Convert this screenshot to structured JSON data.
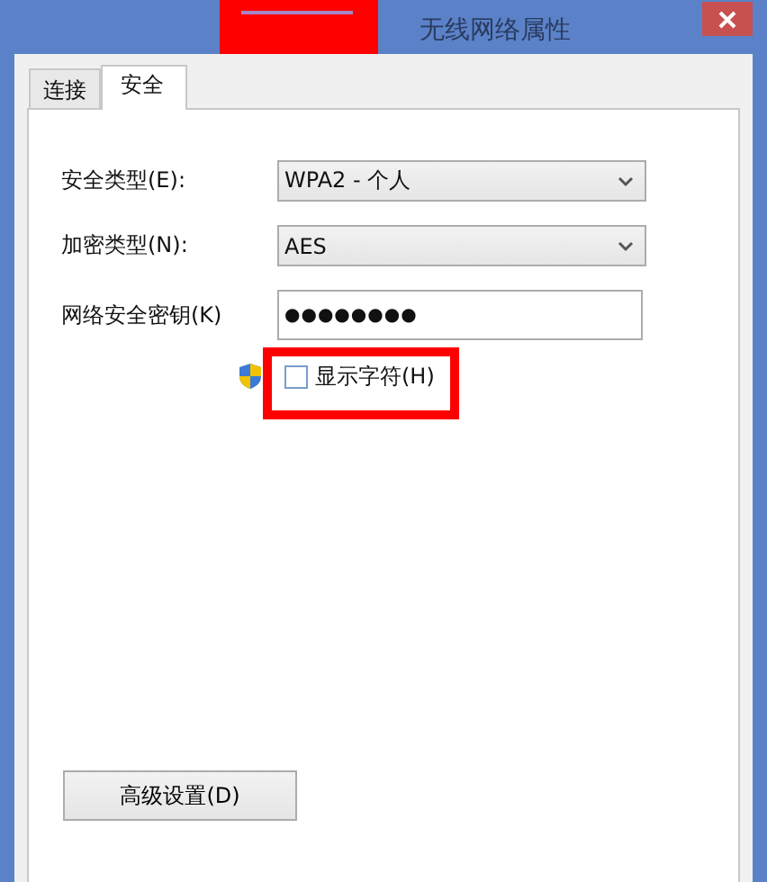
{
  "window": {
    "title": "无线网络属性"
  },
  "tabs": [
    {
      "label": "连接",
      "selected": false
    },
    {
      "label": "安全",
      "selected": true
    }
  ],
  "fields": [
    {
      "kind": "select",
      "label": "安全类型(E):",
      "value": "WPA2 - 个人"
    },
    {
      "kind": "select",
      "label": "加密类型(N):",
      "value": "AES"
    },
    {
      "kind": "password",
      "label": "网络安全密钥(K)",
      "value": "●●●●●●●●"
    }
  ],
  "show_characters": {
    "label": "显示字符(H)",
    "checked": false
  },
  "advanced_button": {
    "label": "高级设置(D)"
  }
}
